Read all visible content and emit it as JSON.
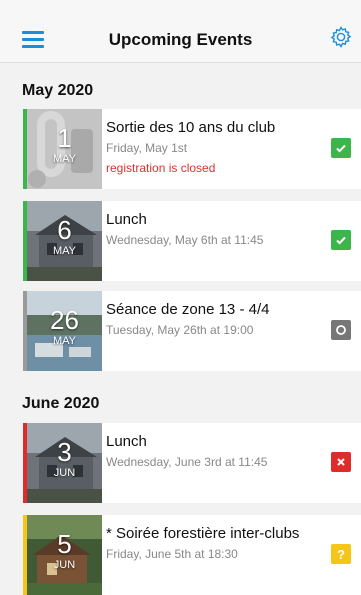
{
  "header": {
    "title": "Upcoming Events"
  },
  "colors": {
    "accent": "#1a8fd8",
    "green": "#3cb54a",
    "gray": "#777777",
    "red": "#e02b2b",
    "yellow": "#f5c518",
    "closed_text": "#e03030"
  },
  "months": [
    {
      "label": "May 2020",
      "events": [
        {
          "day": "1",
          "month": "MAY",
          "title": "Sortie des 10 ans du club",
          "date": "Friday, May 1st",
          "note": "registration is closed",
          "status": "registered",
          "status_icon": "check-icon"
        },
        {
          "day": "6",
          "month": "MAY",
          "title": "Lunch",
          "date": "Wednesday, May 6th at 11:45",
          "note": "",
          "status": "registered",
          "status_icon": "check-icon"
        },
        {
          "day": "26",
          "month": "MAY",
          "title": "Séance de zone 13 - 4/4",
          "date": "Tuesday, May 26th at 19:00",
          "note": "",
          "status": "no-response",
          "status_icon": "circle-icon"
        }
      ]
    },
    {
      "label": "June 2020",
      "events": [
        {
          "day": "3",
          "month": "JUN",
          "title": "Lunch",
          "date": "Wednesday, June 3rd at 11:45",
          "note": "",
          "status": "declined",
          "status_icon": "x-icon"
        },
        {
          "day": "5",
          "month": "JUN",
          "title": "* Soirée forestière inter-clubs",
          "date": "Friday, June 5th at 18:30",
          "note": "",
          "status": "maybe",
          "status_icon": "question-icon"
        }
      ]
    }
  ]
}
